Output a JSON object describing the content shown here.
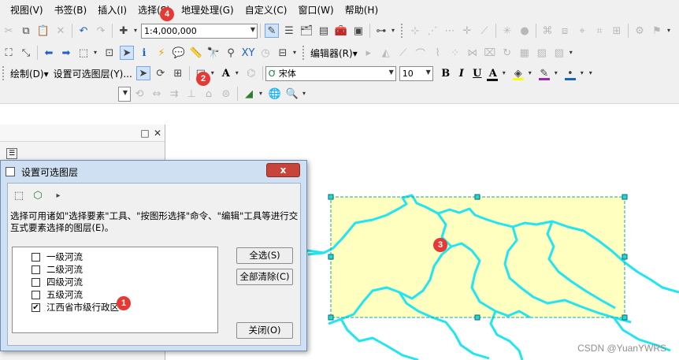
{
  "menubar": {
    "items": [
      "视图(V)",
      "书签(B)",
      "插入(I)",
      "选择(S)",
      "地理处理(G)",
      "自定义(C)",
      "窗口(W)",
      "帮助(H)"
    ]
  },
  "toolbar": {
    "scale": "1:4,000,000",
    "editor_label": "编辑器(R)▾",
    "draw_label": "绘制(D)▾",
    "set_selectable_label": "设置可选图层(Y)...",
    "font_name": "宋体",
    "font_size": "10",
    "bold": "B",
    "italic": "I",
    "underline": "U",
    "font_color_glyph": "A",
    "text_tool_glyph": "A"
  },
  "colors": {
    "accent_blue": "#1e63c4",
    "badge_red": "#e53935",
    "polygon_fill": "#ffffc0",
    "river_cyan": "#21e5f0",
    "font_color_bar": "#111111",
    "fill_color_bar": "#ffff00",
    "line_color_bar": "#9c27b0",
    "marker_color": "#1565c0"
  },
  "dialog": {
    "title": "设置可选图层",
    "close_glyph": "x",
    "description": "选择可用诸如\"选择要素\"工具、\"按图形选择\"命令、\"编辑\"工具等进行交互式要素选择的图层(E)。",
    "layers": [
      {
        "name": "一级河流",
        "checked": false
      },
      {
        "name": "二级河流",
        "checked": false
      },
      {
        "name": "四级河流",
        "checked": false
      },
      {
        "name": "五级河流",
        "checked": false
      },
      {
        "name": "江西省市级行政区",
        "checked": true
      }
    ],
    "buttons": {
      "select_all": "全选(S)",
      "clear_all": "全部清除(C)",
      "close": "关闭(O)"
    },
    "check_glyph": "✔"
  },
  "toc": {
    "close_glyph": "✕",
    "restore_glyph": "□"
  },
  "annotations": [
    "1",
    "2",
    "3",
    "4"
  ],
  "watermark": "CSDN @YuanYWRS"
}
